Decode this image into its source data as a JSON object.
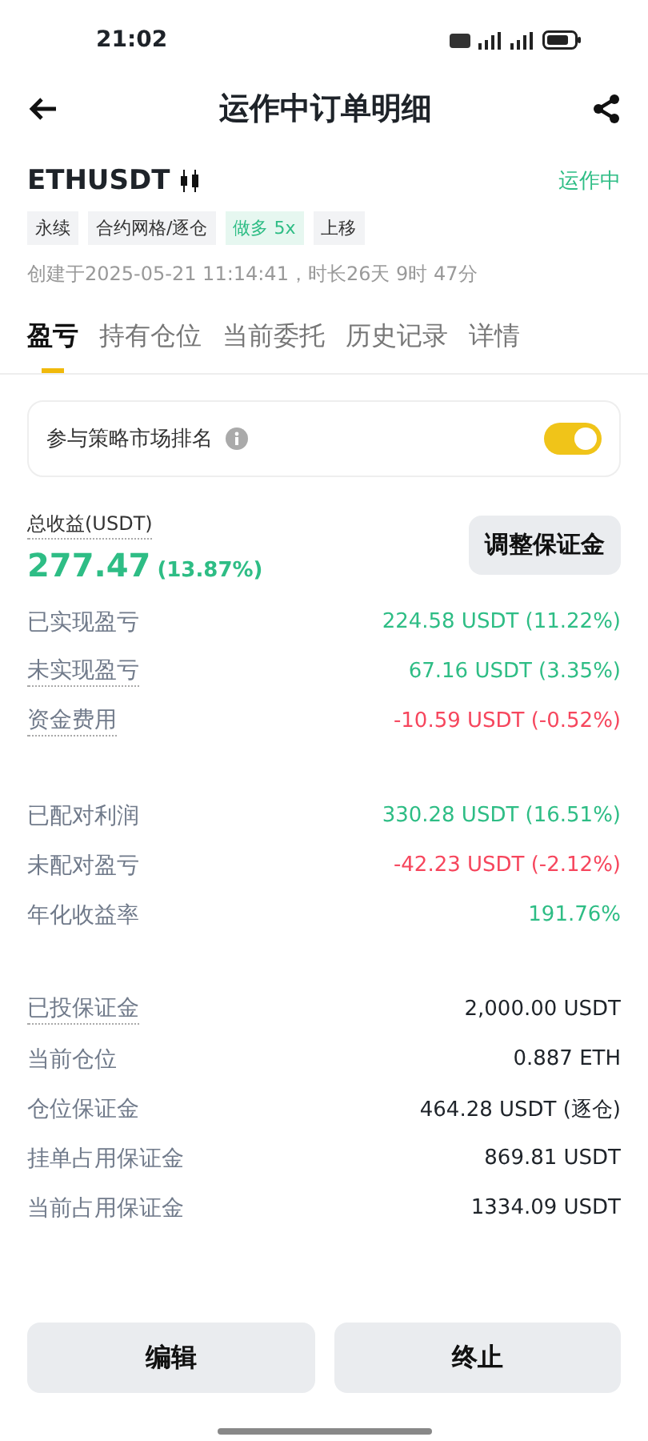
{
  "status_bar": {
    "time": "21:02"
  },
  "header": {
    "title": "运作中订单明细"
  },
  "order": {
    "symbol": "ETHUSDT",
    "status": "运作中",
    "tags": [
      {
        "label": "永续",
        "kind": "plain"
      },
      {
        "label": "合约网格/逐仓",
        "kind": "plain"
      },
      {
        "label": "做多 5x",
        "kind": "long"
      },
      {
        "label": "上移",
        "kind": "plain"
      }
    ],
    "created": "创建于2025-05-21 11:14:41，时长26天 9时 47分"
  },
  "tabs": [
    {
      "label": "盈亏",
      "selected": true
    },
    {
      "label": "持有仓位",
      "selected": false
    },
    {
      "label": "当前委托",
      "selected": false
    },
    {
      "label": "历史记录",
      "selected": false
    },
    {
      "label": "详情",
      "selected": false
    }
  ],
  "ranking": {
    "label": "参与策略市场排名",
    "on": true
  },
  "total": {
    "label": "总收益(USDT)",
    "value": "277.47",
    "percent": "(13.87%)",
    "button": "调整保证金"
  },
  "groups": [
    [
      {
        "label": "已实现盈亏",
        "value": "224.58 USDT (11.22%)",
        "color": "#2ebd85",
        "dotted": false
      },
      {
        "label": "未实现盈亏",
        "value": "67.16 USDT (3.35%)",
        "color": "#2ebd85",
        "dotted": true
      },
      {
        "label": "资金费用",
        "value": "-10.59 USDT (-0.52%)",
        "color": "#f6465d",
        "dotted": true
      }
    ],
    [
      {
        "label": "已配对利润",
        "value": "330.28 USDT (16.51%)",
        "color": "#2ebd85",
        "dotted": false
      },
      {
        "label": "未配对盈亏",
        "value": "-42.23 USDT (-2.12%)",
        "color": "#f6465d",
        "dotted": false
      },
      {
        "label": "年化收益率",
        "value": "191.76%",
        "color": "#2ebd85",
        "dotted": false
      }
    ],
    [
      {
        "label": "已投保证金",
        "value": "2,000.00  USDT",
        "color": "#1e2329",
        "dotted": true
      },
      {
        "label": "当前仓位",
        "value": "0.887 ETH",
        "color": "#1e2329",
        "dotted": false
      },
      {
        "label": "仓位保证金",
        "value": "464.28 USDT (逐仓)",
        "color": "#1e2329",
        "dotted": false
      },
      {
        "label": "挂单占用保证金",
        "value": "869.81 USDT",
        "color": "#1e2329",
        "dotted": false
      },
      {
        "label": "当前占用保证金",
        "value": "1334.09 USDT",
        "color": "#1e2329",
        "dotted": false
      }
    ]
  ],
  "actions": [
    "编辑",
    "终止"
  ]
}
